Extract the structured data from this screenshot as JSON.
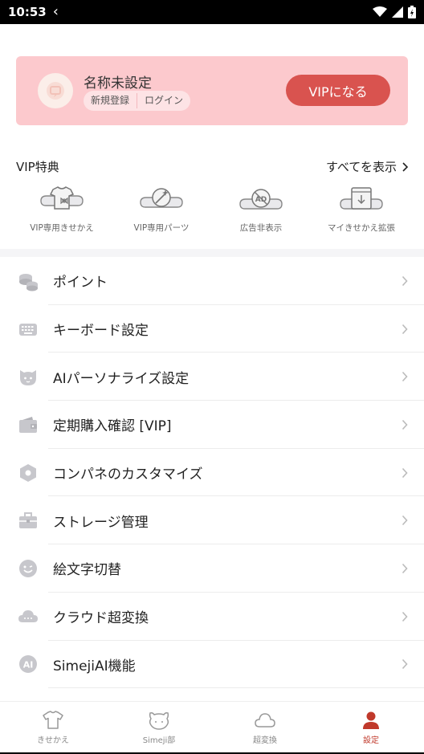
{
  "status_bar": {
    "time": "10:53"
  },
  "profile": {
    "name": "名称未設定",
    "register_label": "新規登録",
    "login_label": "ログイン",
    "vip_button_label": "VIPになる"
  },
  "benefits": {
    "title": "VIP特典",
    "see_all_label": "すべてを表示",
    "items": [
      {
        "label": "VIP専用きせかえ",
        "icon": "tshirt-bow-icon"
      },
      {
        "label": "VIP専用パーツ",
        "icon": "magic-wand-icon"
      },
      {
        "label": "広告非表示",
        "icon": "ad-block-icon"
      },
      {
        "label": "マイきせかえ拡張",
        "icon": "download-box-icon"
      }
    ]
  },
  "menu": {
    "items": [
      {
        "label": "ポイント",
        "icon": "coins-icon"
      },
      {
        "label": "キーボード設定",
        "icon": "keyboard-icon"
      },
      {
        "label": "AIパーソナライズ設定",
        "icon": "cat-face-icon"
      },
      {
        "label": "定期購入確認 [VIP]",
        "icon": "wallet-icon"
      },
      {
        "label": "コンパネのカスタマイズ",
        "icon": "hexagon-icon"
      },
      {
        "label": "ストレージ管理",
        "icon": "briefcase-icon"
      },
      {
        "label": "絵文字切替",
        "icon": "smiley-icon"
      },
      {
        "label": "クラウド超変換",
        "icon": "cloud-icon"
      },
      {
        "label": "SimejiAI機能",
        "icon": "ai-badge-icon"
      }
    ]
  },
  "bottom_nav": {
    "tabs": [
      {
        "label": "きせかえ",
        "icon": "tshirt-icon"
      },
      {
        "label": "Simeji部",
        "icon": "bear-face-icon"
      },
      {
        "label": "超変換",
        "icon": "cloud-icon"
      },
      {
        "label": "設定",
        "icon": "person-icon",
        "active": true
      }
    ]
  },
  "colors": {
    "accent": "#d9534f",
    "card_background": "#fcc9cd",
    "active_tab": "#c0392b"
  }
}
